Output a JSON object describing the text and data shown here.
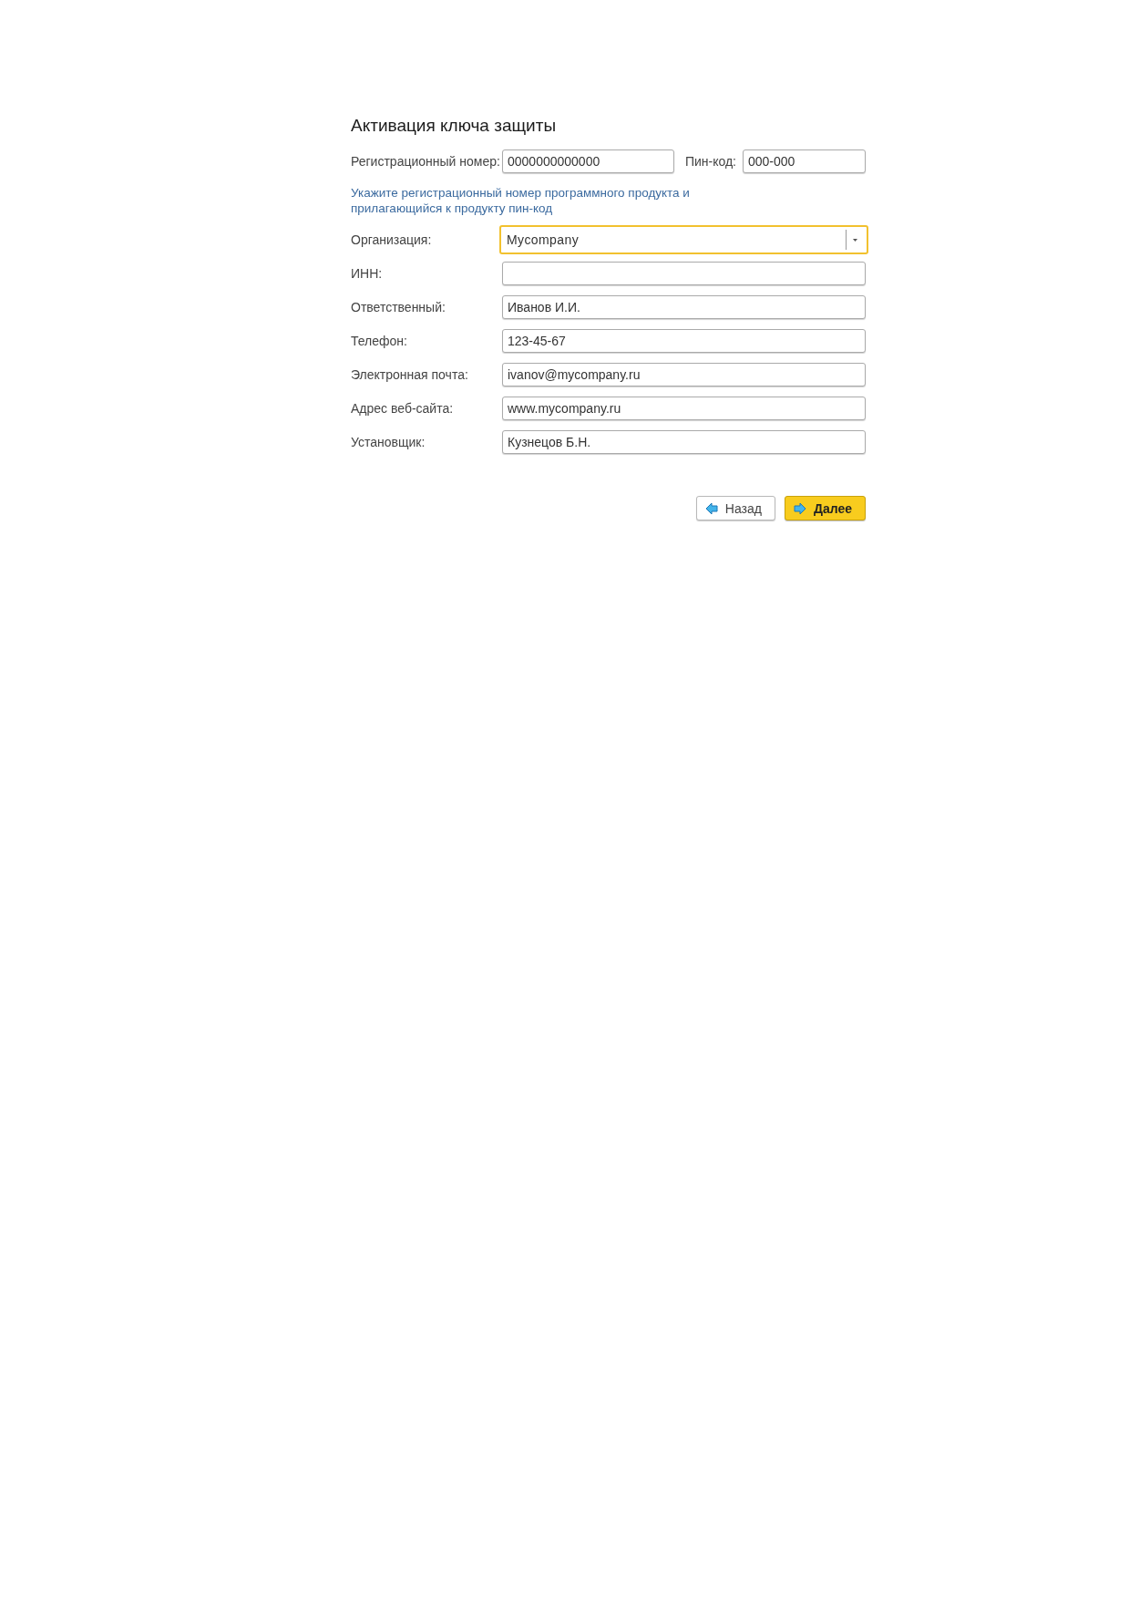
{
  "title": "Активация ключа защиты",
  "registration": {
    "label": "Регистрационный номер:",
    "value": "0000000000000"
  },
  "pin_code": {
    "label": "Пин-код:",
    "value": "000-000"
  },
  "hint": "Укажите регистрационный номер программного продукта и прилагающийся к продукту пин-код",
  "fields": [
    {
      "kind": "select",
      "label": "Организация:",
      "value": "Mycompany",
      "focused": true
    },
    {
      "kind": "text",
      "label": "ИНН:",
      "focused": false
    },
    {
      "kind": "text",
      "label": "Ответственный:",
      "value": "Иванов И.И.",
      "focused": false
    },
    {
      "kind": "text",
      "label": "Телефон:",
      "value": "123-45-67",
      "focused": false
    },
    {
      "kind": "text",
      "label": "Электронная почта:",
      "value": "ivanov@mycompany.ru",
      "focused": false
    },
    {
      "kind": "text",
      "label": "Адрес веб-сайта:",
      "value": "www.mycompany.ru",
      "focused": false
    },
    {
      "kind": "text",
      "label": "Установщик:",
      "value": "Кузнецов Б.Н.",
      "focused": false
    }
  ],
  "buttons": [
    {
      "kind": "back",
      "label": "Назад",
      "default": false
    },
    {
      "kind": "next",
      "label": "Далее",
      "default": true
    }
  ]
}
